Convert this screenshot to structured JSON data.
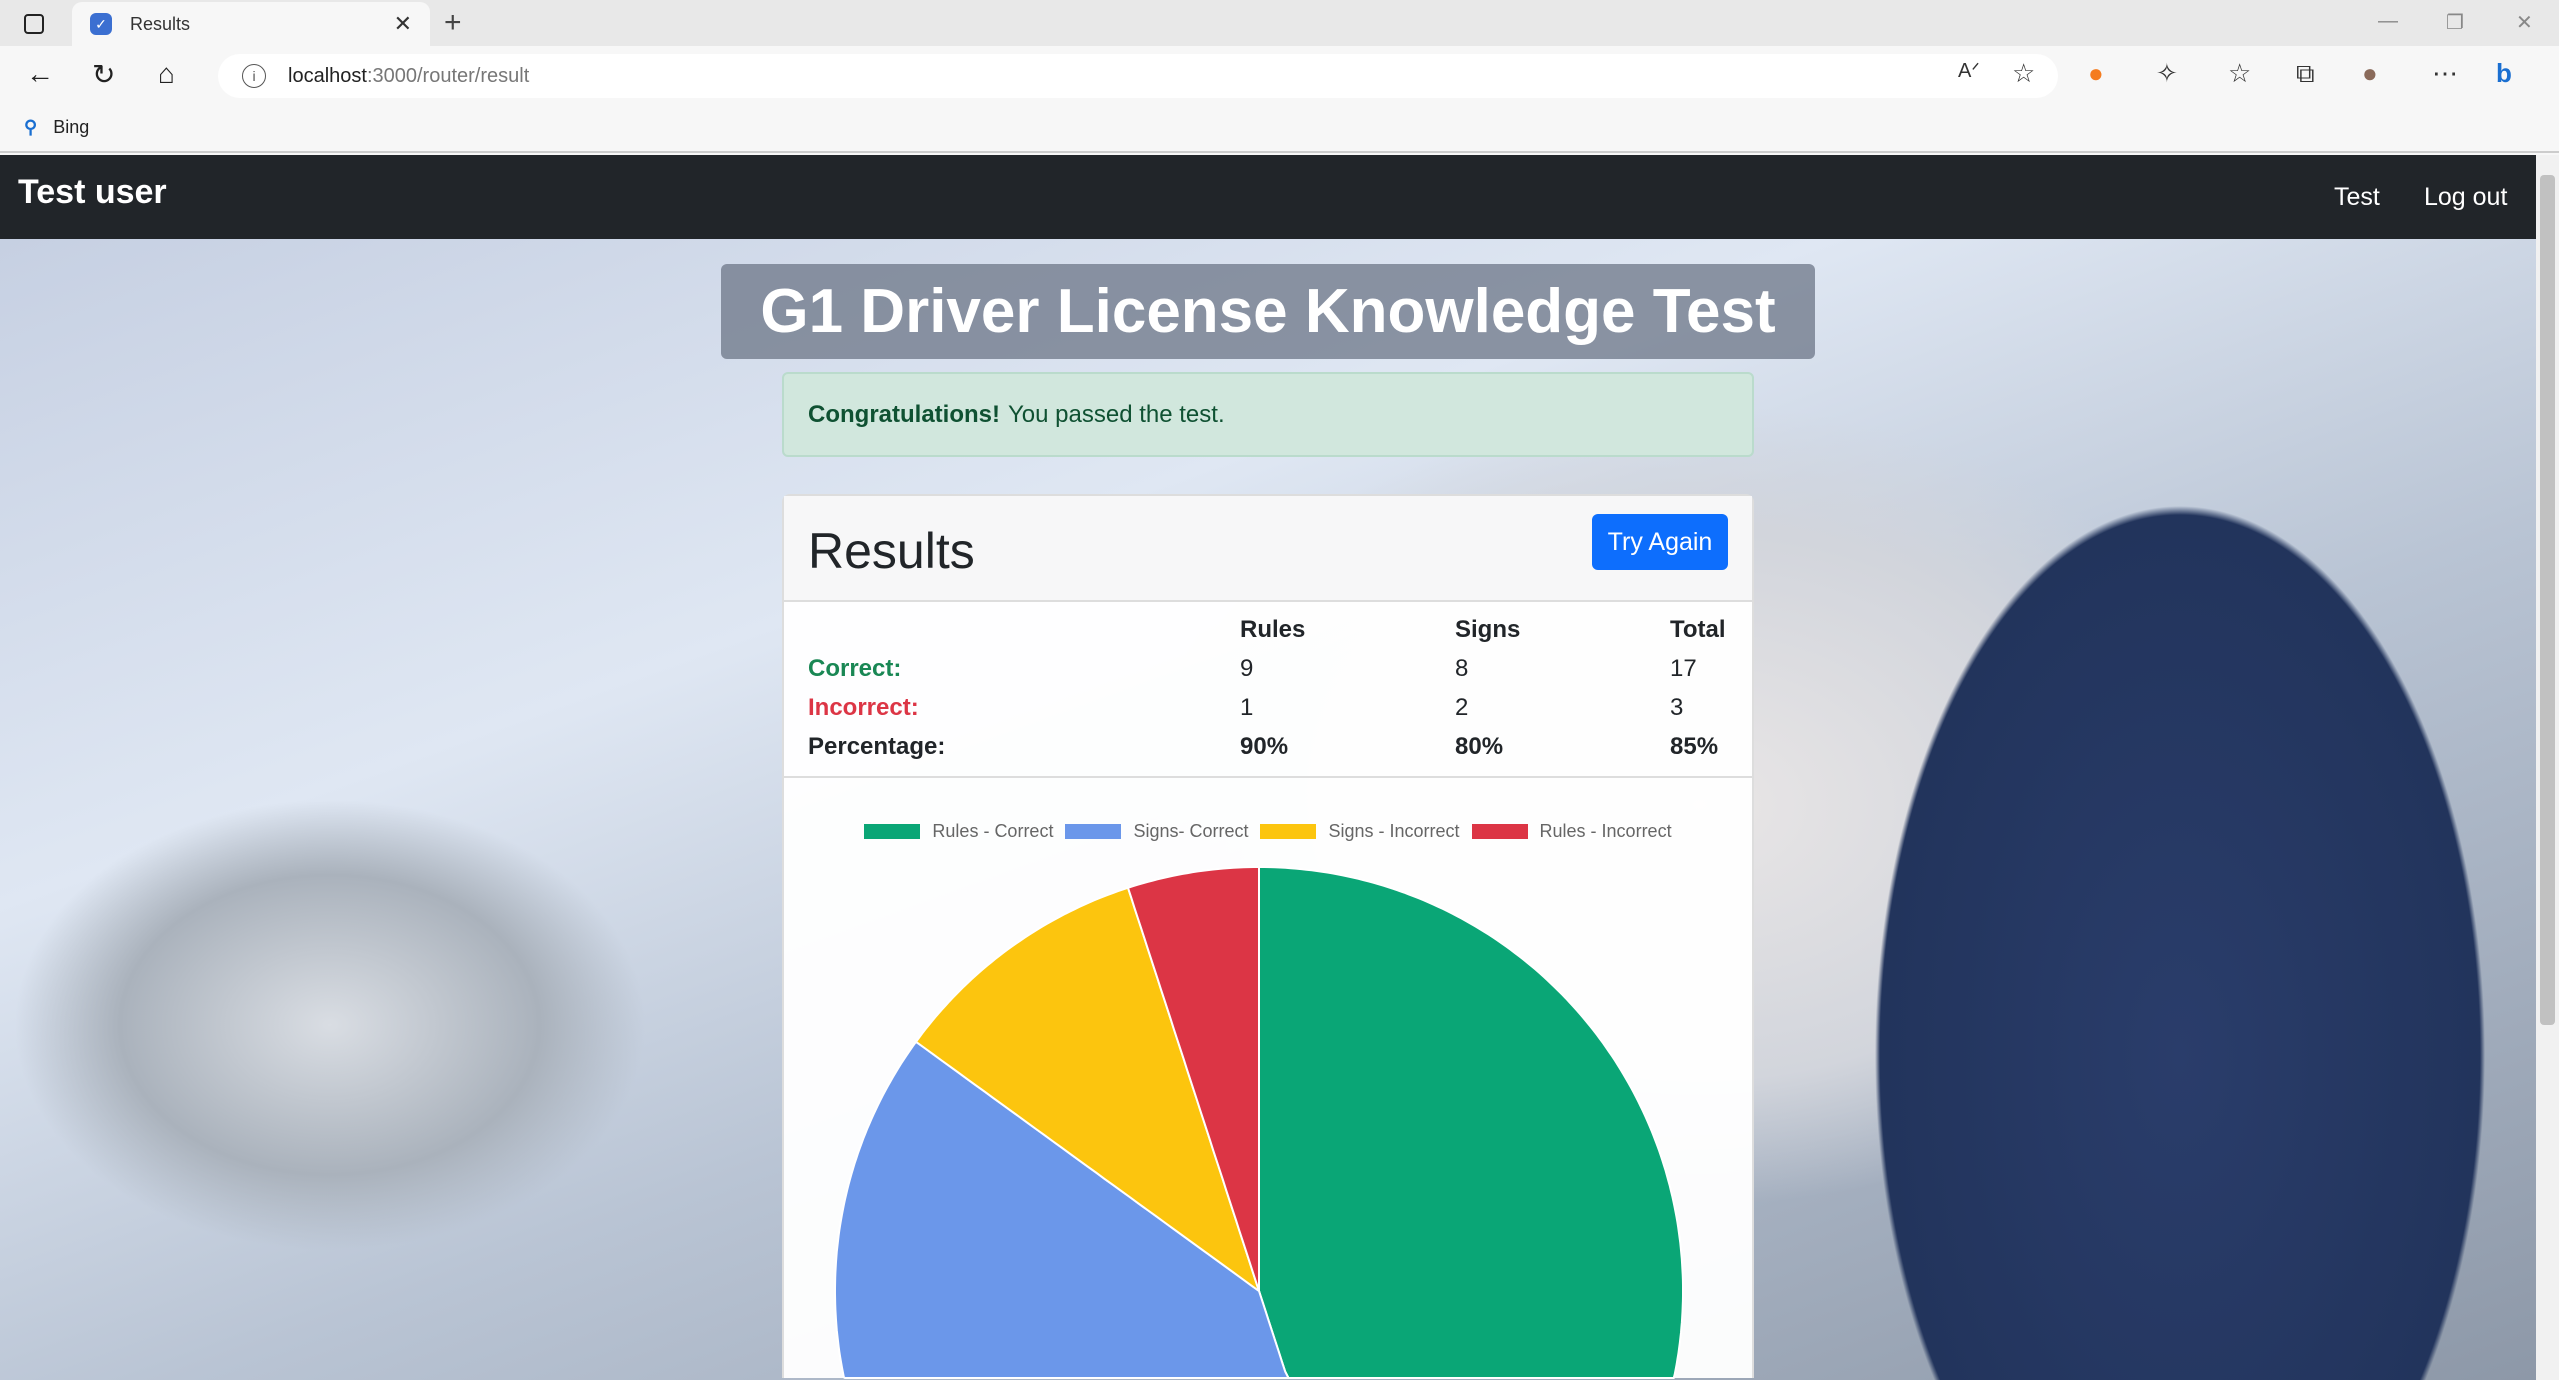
{
  "browser": {
    "tab_title": "Results",
    "url_host": "localhost",
    "url_path": ":3000/router/result",
    "favorites": [
      {
        "label": "Bing"
      }
    ]
  },
  "navbar": {
    "brand": "Test user",
    "links": [
      "Test",
      "Log out"
    ]
  },
  "page": {
    "title": "G1 Driver License Knowledge Test"
  },
  "alert": {
    "strong": "Congratulations!",
    "text": "You passed the test."
  },
  "card": {
    "title": "Results",
    "try_again": "Try Again",
    "table": {
      "headers": [
        "",
        "Rules",
        "Signs",
        "Total"
      ],
      "rows": [
        [
          "Correct:",
          "9",
          "8",
          "17"
        ],
        [
          "Incorrect:",
          "1",
          "2",
          "3"
        ],
        [
          "Percentage:",
          "90%",
          "80%",
          "85%"
        ]
      ]
    }
  },
  "chart_data": {
    "type": "pie",
    "legend_position": "top",
    "categories": [
      "Rules - Correct",
      "Signs- Correct",
      "Signs - Incorrect",
      "Rules - Incorrect"
    ],
    "values": [
      9,
      8,
      2,
      1
    ],
    "colors": [
      "#0aa676",
      "#6b97ea",
      "#fcc50e",
      "#dc3545"
    ]
  }
}
